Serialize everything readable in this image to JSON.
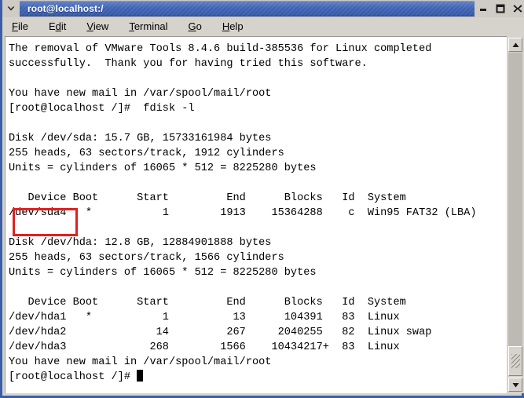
{
  "window": {
    "title": "root@localhost:/",
    "menu_button_icon": "chevron-down-icon",
    "minimize_label": "–",
    "maximize_label": "□",
    "close_label": "✕"
  },
  "menubar": {
    "items": [
      {
        "label": "File",
        "mnemonic": "F"
      },
      {
        "label": "Edit",
        "mnemonic": "E"
      },
      {
        "label": "View",
        "mnemonic": "V"
      },
      {
        "label": "Terminal",
        "mnemonic": "T"
      },
      {
        "label": "Go",
        "mnemonic": "G"
      },
      {
        "label": "Help",
        "mnemonic": "H"
      }
    ]
  },
  "terminal": {
    "lines": [
      "The removal of VMware Tools 8.4.6 build-385536 for Linux completed",
      "successfully.  Thank you for having tried this software.",
      "",
      "You have new mail in /var/spool/mail/root",
      "[root@localhost /]#  fdisk -l",
      "",
      "Disk /dev/sda: 15.7 GB, 15733161984 bytes",
      "255 heads, 63 sectors/track, 1912 cylinders",
      "Units = cylinders of 16065 * 512 = 8225280 bytes",
      "",
      "   Device Boot      Start         End      Blocks   Id  System",
      "/dev/sda4   *           1        1913    15364288    c  Win95 FAT32 (LBA)",
      "",
      "Disk /dev/hda: 12.8 GB, 12884901888 bytes",
      "255 heads, 63 sectors/track, 1566 cylinders",
      "Units = cylinders of 16065 * 512 = 8225280 bytes",
      "",
      "   Device Boot      Start         End      Blocks   Id  System",
      "/dev/hda1   *           1          13      104391   83  Linux",
      "/dev/hda2              14         267     2040255   82  Linux swap",
      "/dev/hda3             268        1566    10434217+  83  Linux",
      "You have new mail in /var/spool/mail/root"
    ],
    "prompt": "[root@localhost /]# ",
    "cursor": "block-cursor"
  },
  "annotation": {
    "type": "red-rectangle-highlight",
    "color": "#e02020",
    "target_text": "/dev/sda4"
  },
  "scrollbar": {
    "up_arrow_icon": "triangle-up-icon",
    "down_arrow_icon": "triangle-down-icon",
    "thumb_icon": "scrollbar-thumb"
  }
}
